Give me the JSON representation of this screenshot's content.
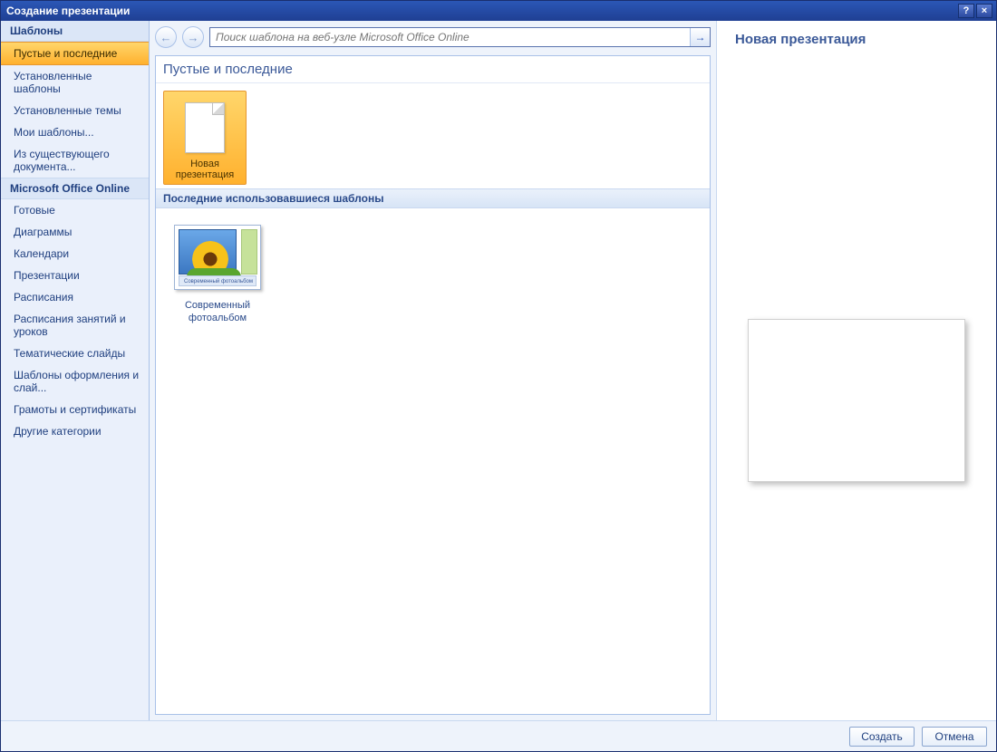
{
  "window": {
    "title": "Создание презентации",
    "help_tooltip": "?",
    "close_tooltip": "×"
  },
  "sidebar": {
    "heading_templates": "Шаблоны",
    "heading_online": "Microsoft Office Online",
    "items_top": [
      "Пустые и последние",
      "Установленные шаблоны",
      "Установленные темы",
      "Мои шаблоны...",
      "Из существующего документа..."
    ],
    "items_online": [
      "Готовые",
      "Диаграммы",
      "Календари",
      "Презентации",
      "Расписания",
      "Расписания занятий и уроков",
      "Тематические слайды",
      "Шаблоны оформления и слай...",
      "Грамоты и сертификаты",
      "Другие категории"
    ]
  },
  "search": {
    "placeholder": "Поиск шаблона на веб-узле Microsoft Office Online",
    "go_glyph": "→"
  },
  "main": {
    "section_title": "Пустые и последние",
    "tile_blank_line1": "Новая",
    "tile_blank_line2": "презентация",
    "recent_heading": "Последние использовавшиеся шаблоны",
    "recent_item_caption_bar": "Современный фотоальбом",
    "recent_item_label_line1": "Современный",
    "recent_item_label_line2": "фотоальбом"
  },
  "preview": {
    "title": "Новая презентация"
  },
  "footer": {
    "create": "Создать",
    "cancel": "Отмена"
  },
  "nav": {
    "back_glyph": "←",
    "forward_glyph": "→"
  }
}
